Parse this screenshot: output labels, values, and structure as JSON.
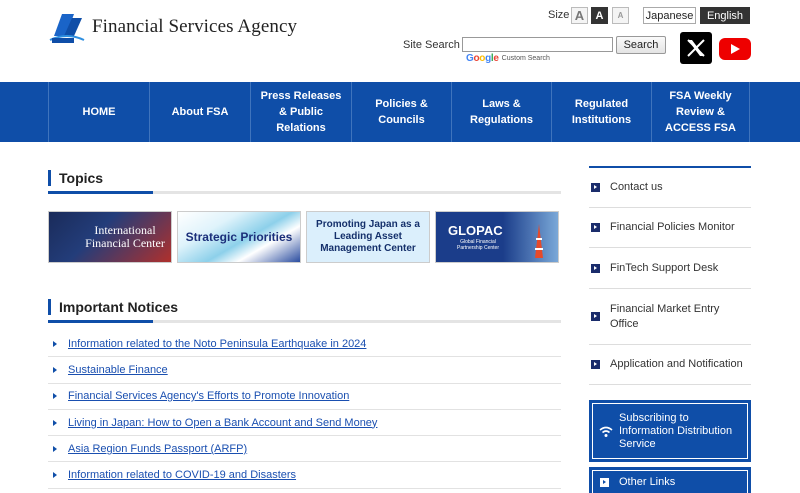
{
  "header": {
    "logo_text": "Financial Services Agency",
    "size_label": "Size",
    "size_buttons": [
      "A",
      "A",
      "A"
    ],
    "lang_japanese": "Japanese",
    "lang_english": "English",
    "search_label": "Site Search",
    "search_value": "",
    "search_button": "Search",
    "google_brand": "Google",
    "google_note": "Custom Search",
    "social_icons": [
      "x-icon",
      "youtube-icon"
    ]
  },
  "nav": {
    "items": [
      "HOME",
      "About FSA",
      "Press Releases & Public Relations",
      "Policies & Councils",
      "Laws & Regulations",
      "Regulated Institutions",
      "FSA Weekly Review & ACCESS FSA"
    ]
  },
  "topics": {
    "title": "Topics",
    "banners": [
      "International Financial Center",
      "Strategic Priorities",
      "Promoting Japan as a Leading Asset Management Center",
      "GLOPAC",
      "Global Financial Partnership Center"
    ]
  },
  "notices": {
    "title": "Important Notices",
    "items": [
      "Information related to the Noto Peninsula Earthquake in 2024",
      "Sustainable Finance",
      "Financial Services Agency's Efforts to Promote Innovation",
      "Living in Japan: How to Open a Bank Account and Send Money",
      "Asia Region Funds Passport (ARFP)",
      "Information related to COVID-19 and Disasters"
    ]
  },
  "sidebar": {
    "items": [
      "Contact us",
      "Financial Policies Monitor",
      "FinTech Support Desk",
      "Financial Market Entry Office",
      "Application and Notification"
    ],
    "subscribe": "Subscribing to Information Distribution Service",
    "other_links": "Other Links"
  },
  "colors": {
    "brand_blue": "#0f4ea8",
    "nav_text": "#ffffff",
    "link": "#1a4fb0"
  }
}
